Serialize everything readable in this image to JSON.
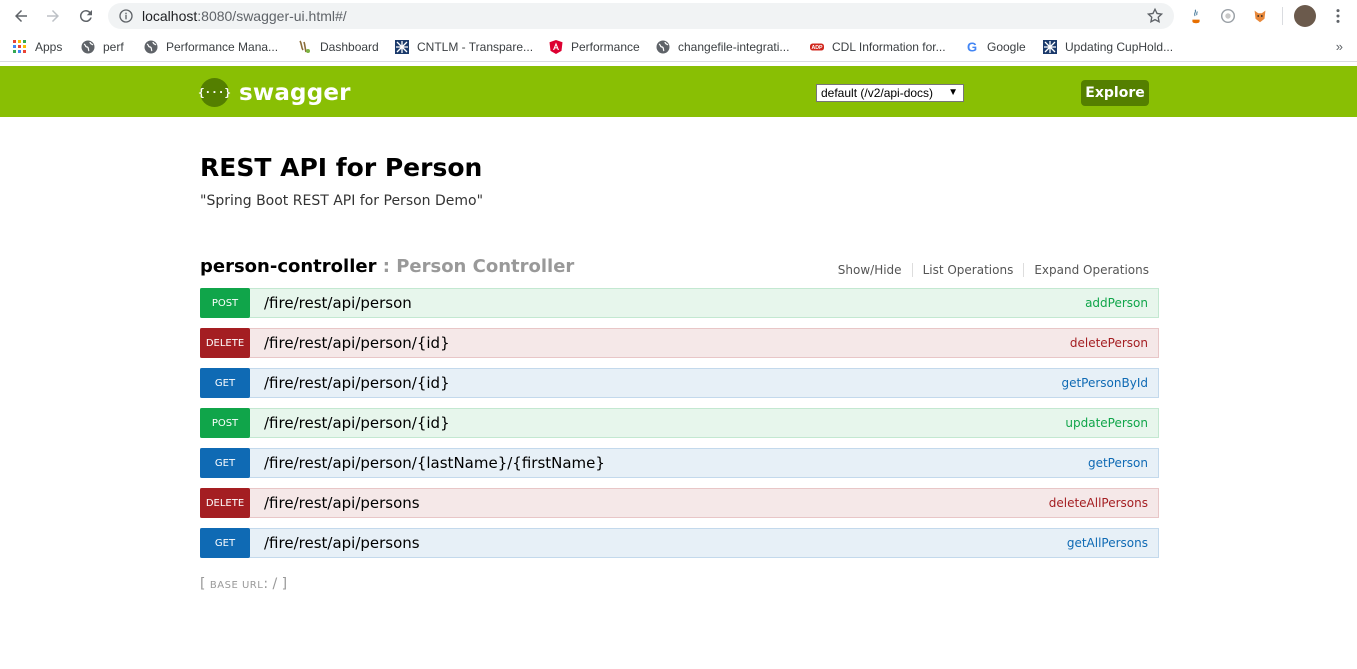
{
  "browser": {
    "url_host": "localhost",
    "url_rest": ":8080/swagger-ui.html#/",
    "bookmarks": [
      {
        "label": "Apps",
        "icon": "apps-grid-icon"
      },
      {
        "label": "perf",
        "icon": "globe-icon"
      },
      {
        "label": "Performance Mana...",
        "icon": "globe-icon"
      },
      {
        "label": "Dashboard",
        "icon": "dashboard-icon"
      },
      {
        "label": "CNTLM - Transpare...",
        "icon": "cntlm-icon"
      },
      {
        "label": "Performance",
        "icon": "angular-icon"
      },
      {
        "label": "changefile-integrati...",
        "icon": "globe-icon"
      },
      {
        "label": "CDL Information for...",
        "icon": "adp-icon"
      },
      {
        "label": "Google",
        "icon": "google-icon"
      },
      {
        "label": "Updating CupHold...",
        "icon": "cntlm-icon"
      }
    ],
    "more": "»"
  },
  "swagger": {
    "logo_glyph": "{···}",
    "logo_text": "swagger",
    "api_select": "default (/v2/api-docs)",
    "explore_label": "Explore"
  },
  "info": {
    "title": "REST API for Person",
    "description": "\"Spring Boot REST API for Person Demo\""
  },
  "resource": {
    "name": "person-controller",
    "separator_desc": " : Person Controller",
    "show_hide": "Show/Hide",
    "list_operations": "List Operations",
    "expand_operations": "Expand Operations"
  },
  "operations": [
    {
      "method": "POST",
      "path": "/fire/rest/api/person",
      "name": "addPerson"
    },
    {
      "method": "DELETE",
      "path": "/fire/rest/api/person/{id}",
      "name": "deletePerson"
    },
    {
      "method": "GET",
      "path": "/fire/rest/api/person/{id}",
      "name": "getPersonById"
    },
    {
      "method": "POST",
      "path": "/fire/rest/api/person/{id}",
      "name": "updatePerson"
    },
    {
      "method": "GET",
      "path": "/fire/rest/api/person/{lastName}/{firstName}",
      "name": "getPerson"
    },
    {
      "method": "DELETE",
      "path": "/fire/rest/api/persons",
      "name": "deleteAllPersons"
    },
    {
      "method": "GET",
      "path": "/fire/rest/api/persons",
      "name": "getAllPersons"
    }
  ],
  "base_url": {
    "open": "[ ",
    "label": "BASE URL",
    "value": ": / ]"
  },
  "colors": {
    "swagger_green": "#89bf04",
    "post": "#10a54a",
    "delete": "#a41e22",
    "get": "#0f6ab4"
  }
}
